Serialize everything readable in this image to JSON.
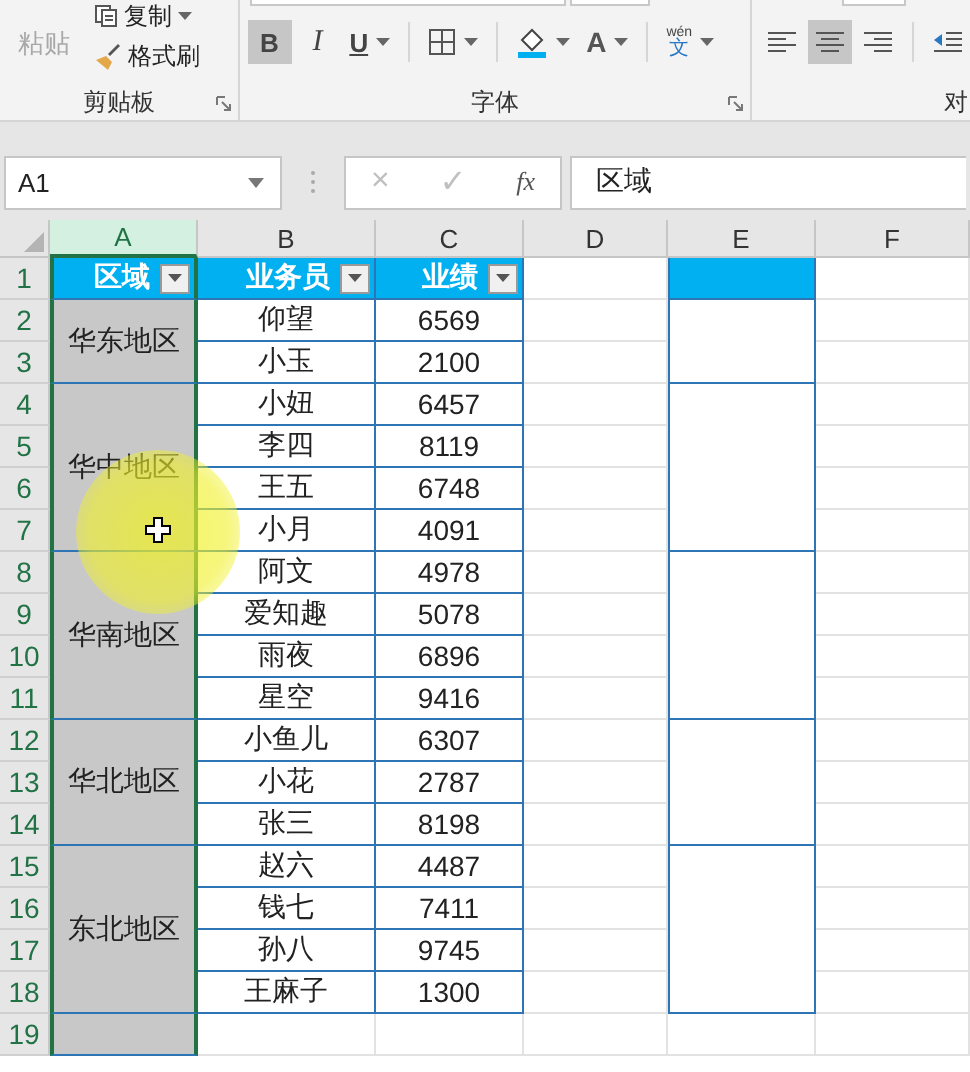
{
  "ribbon": {
    "clipboard": {
      "paste": {
        "label": "粘贴",
        "disabled": true
      },
      "copy": {
        "label": "复制"
      },
      "format_painter": {
        "label": "格式刷"
      },
      "group_label": "剪贴板"
    },
    "font": {
      "button_groups": [
        [
          {
            "kind": "bold",
            "label": "B",
            "selected": true
          },
          {
            "kind": "italic",
            "label": "I",
            "selected": false
          },
          {
            "kind": "underline",
            "label": "U",
            "selected": false,
            "dropdown": true
          }
        ],
        [
          {
            "kind": "borders",
            "selected": false,
            "dropdown": true
          }
        ],
        [
          {
            "kind": "fill",
            "selected": false,
            "dropdown": true
          },
          {
            "kind": "font_color",
            "label": "A",
            "selected": false,
            "dropdown": true
          }
        ],
        [
          {
            "kind": "phonetic",
            "label": "wén",
            "sublabel": "文",
            "selected": false,
            "dropdown": true
          }
        ]
      ],
      "group_label": "字体"
    },
    "alignment": {
      "button_groups": [
        [
          {
            "kind": "left",
            "selected": false
          },
          {
            "kind": "center",
            "selected": true
          },
          {
            "kind": "right",
            "selected": false
          }
        ],
        [
          {
            "kind": "indent",
            "selected": false
          }
        ]
      ],
      "group_label": "对"
    }
  },
  "formula_bar": {
    "name_box": "A1",
    "buttons": [
      {
        "label": "×",
        "disabled": true
      },
      {
        "label": "✓",
        "disabled": true
      },
      {
        "label": "fx",
        "disabled": false
      }
    ],
    "formula": "区域"
  },
  "sheet": {
    "columns": [
      {
        "label": "A",
        "selected": true
      },
      {
        "label": "B",
        "selected": false
      },
      {
        "label": "C",
        "selected": false
      },
      {
        "label": "D",
        "selected": false
      },
      {
        "label": "E",
        "selected": false
      },
      {
        "label": "F",
        "selected": false
      }
    ],
    "row_numbers": [
      "1",
      "2",
      "3",
      "4",
      "5",
      "6",
      "7",
      "8",
      "9",
      "10",
      "11",
      "12",
      "13",
      "14",
      "15",
      "16",
      "17",
      "18",
      "19"
    ],
    "headers": [
      {
        "label": "区域",
        "filter": true
      },
      {
        "label": "业务员",
        "filter": true
      },
      {
        "label": "业绩",
        "filter": true
      }
    ],
    "regions": [
      {
        "name": "华东地区",
        "members": [
          {
            "name": "仰望",
            "sales": "6569"
          },
          {
            "name": "小玉",
            "sales": "2100"
          }
        ]
      },
      {
        "name": "华中地区",
        "members": [
          {
            "name": "小妞",
            "sales": "6457"
          },
          {
            "name": "李四",
            "sales": "8119"
          },
          {
            "name": "王五",
            "sales": "6748"
          },
          {
            "name": "小月",
            "sales": "4091"
          }
        ]
      },
      {
        "name": "华南地区",
        "members": [
          {
            "name": "阿文",
            "sales": "4978"
          },
          {
            "name": "爱知趣",
            "sales": "5078"
          },
          {
            "name": "雨夜",
            "sales": "6896"
          },
          {
            "name": "星空",
            "sales": "9416"
          }
        ]
      },
      {
        "name": "华北地区",
        "members": [
          {
            "name": "小鱼儿",
            "sales": "6307"
          },
          {
            "name": "小花",
            "sales": "2787"
          },
          {
            "name": "张三",
            "sales": "8198"
          }
        ]
      },
      {
        "name": "东北地区",
        "members": [
          {
            "name": "赵六",
            "sales": "4487"
          },
          {
            "name": "钱七",
            "sales": "7411"
          },
          {
            "name": "孙八",
            "sales": "9745"
          },
          {
            "name": "王麻子",
            "sales": "1300"
          }
        ]
      }
    ]
  }
}
